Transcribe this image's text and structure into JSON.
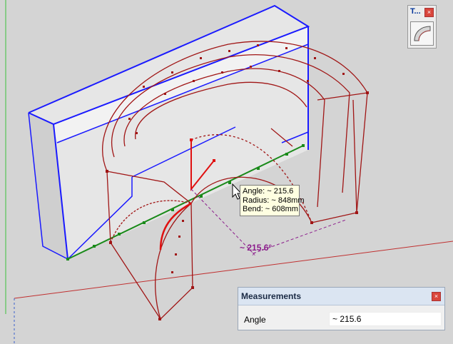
{
  "tooltip": {
    "angle": "Angle: ~ 215.6",
    "radius": "Radius: ~ 848mm",
    "bend": "Bend: ~ 608mm"
  },
  "viewport": {
    "angle_annotation": "~ 215.6°"
  },
  "tool_palette": {
    "title": "T...",
    "close_glyph": "×",
    "icon": "curved-shape-tool-icon"
  },
  "measurements": {
    "title": "Measurements",
    "close_glyph": "×",
    "label": "Angle",
    "value": "~ 215.6"
  },
  "colors": {
    "background": "#d4d4d4",
    "edge_red": "#a01515",
    "bright_red": "#e01010",
    "blue": "#1a1aff",
    "green_axis": "#1a8a1a",
    "purple": "#8b1a8b"
  }
}
